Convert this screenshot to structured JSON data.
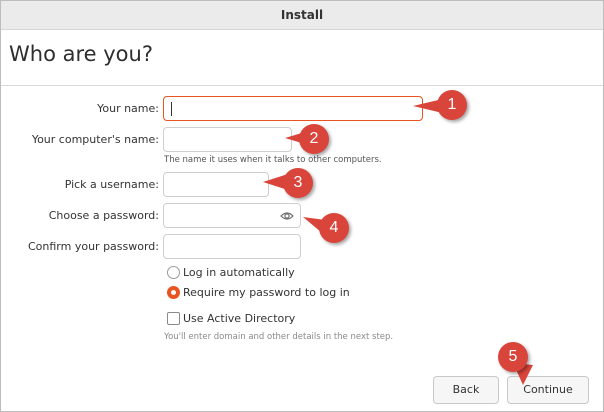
{
  "window": {
    "title": "Install"
  },
  "page": {
    "heading": "Who are you?"
  },
  "form": {
    "name_label": "Your name:",
    "computer_label": "Your computer's name:",
    "computer_hint": "The name it uses when it talks to other computers.",
    "username_label": "Pick a username:",
    "password_label": "Choose a password:",
    "confirm_label": "Confirm your password:",
    "login_auto_label": "Log in automatically",
    "require_password_label": "Require my password to log in",
    "selected_login_option": "Require my password to log in",
    "active_directory_label": "Use Active Directory",
    "active_directory_checked": false,
    "active_directory_hint": "You'll enter domain and other details in the next step."
  },
  "buttons": {
    "back": "Back",
    "continue": "Continue"
  },
  "callouts": [
    "1",
    "2",
    "3",
    "4",
    "5"
  ],
  "colors": {
    "accent": "#e95420",
    "callout": "#d9453a"
  },
  "icons": {
    "password_reveal": "eye-icon"
  }
}
